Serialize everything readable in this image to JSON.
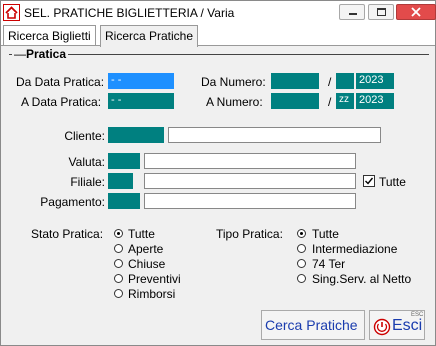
{
  "window": {
    "title": "SEL. PRATICHE BIGLIETTERIA / Varia"
  },
  "tabs": [
    {
      "label": "Ricerca Biglietti"
    },
    {
      "label": "Ricerca Pratiche"
    }
  ],
  "group": {
    "title": "Pratica"
  },
  "form": {
    "da_data_label": "Da Data Pratica:",
    "da_data_value": "- -",
    "a_data_label": "A  Data Pratica:",
    "a_data_value": "- -",
    "da_numero_label": "Da Numero:",
    "da_numero_value": "",
    "da_numero_sep": "/",
    "da_numero_prefix": "",
    "da_numero_year": "2023",
    "a_numero_label": "A  Numero:",
    "a_numero_value": "",
    "a_numero_sep": "/",
    "a_numero_prefix": "zz",
    "a_numero_year": "2023",
    "cliente_label": "Cliente:",
    "valuta_label": "Valuta:",
    "filiale_label": "Filiale:",
    "pagamento_label": "Pagamento:",
    "tutte_checkbox_label": "Tutte",
    "tutte_checked": true
  },
  "stato_pratica": {
    "label": "Stato Pratica:",
    "options": [
      "Tutte",
      "Aperte",
      "Chiuse",
      "Preventivi",
      "Rimborsi"
    ],
    "selected": "Tutte"
  },
  "tipo_pratica": {
    "label": "Tipo Pratica:",
    "options": [
      "Tutte",
      "Intermediazione",
      "74 Ter",
      "Sing.Serv. al Netto"
    ],
    "selected": "Tutte"
  },
  "buttons": {
    "cerca": "Cerca Pratiche",
    "esci": "Esci",
    "esci_badge": "ESC"
  },
  "colors": {
    "field_teal": "#008080",
    "field_blue": "#1e90ff",
    "button_text": "#1a3cae"
  }
}
